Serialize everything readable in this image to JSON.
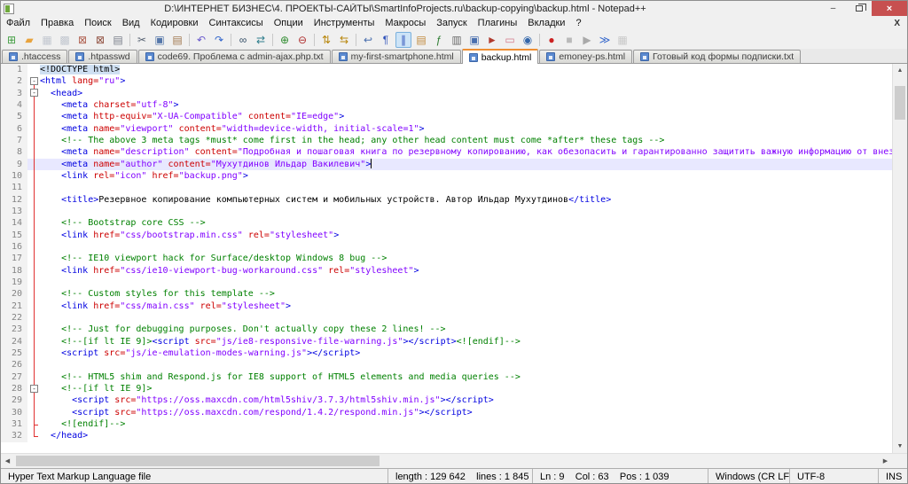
{
  "window": {
    "title": "D:\\ИНТЕРНЕТ БИЗНЕС\\4. ПРОЕКТЫ-САЙТЫ\\SmartInfoProjects.ru\\backup-copying\\backup.html - Notepad++",
    "buttons": {
      "minimize": "–",
      "close": "×"
    },
    "menu_close": "X"
  },
  "menu": [
    "Файл",
    "Правка",
    "Поиск",
    "Вид",
    "Кодировки",
    "Синтаксисы",
    "Опции",
    "Инструменты",
    "Макросы",
    "Запуск",
    "Плагины",
    "Вкладки",
    "?"
  ],
  "toolbar": {
    "groups": [
      [
        {
          "name": "new-file",
          "glyph": "⊞",
          "color": "#3f9d3f"
        },
        {
          "name": "open-file",
          "glyph": "▰",
          "color": "#e8a33d"
        },
        {
          "name": "save-file",
          "glyph": "▦",
          "color": "#8a94a8",
          "disabled": true
        },
        {
          "name": "save-all",
          "glyph": "▩",
          "color": "#8a94a8",
          "disabled": true
        },
        {
          "name": "close-file",
          "glyph": "⊠",
          "color": "#b06050"
        },
        {
          "name": "close-all",
          "glyph": "⊠",
          "color": "#905040"
        },
        {
          "name": "print",
          "glyph": "▤",
          "color": "#7a7f8a"
        }
      ],
      [
        {
          "name": "cut",
          "glyph": "✂",
          "color": "#556070"
        },
        {
          "name": "copy",
          "glyph": "▣",
          "color": "#5577aa"
        },
        {
          "name": "paste",
          "glyph": "▤",
          "color": "#a07850"
        }
      ],
      [
        {
          "name": "undo",
          "glyph": "↶",
          "color": "#6a5acd"
        },
        {
          "name": "redo",
          "glyph": "↷",
          "color": "#3366cc"
        }
      ],
      [
        {
          "name": "find",
          "glyph": "∞",
          "color": "#334d66"
        },
        {
          "name": "replace",
          "glyph": "⇄",
          "color": "#2e7d8c"
        }
      ],
      [
        {
          "name": "zoom-in",
          "glyph": "⊕",
          "color": "#2e8b2e"
        },
        {
          "name": "zoom-out",
          "glyph": "⊖",
          "color": "#b03030"
        }
      ],
      [
        {
          "name": "sync-vertical-scroll",
          "glyph": "⇅",
          "color": "#b8860b"
        },
        {
          "name": "sync-horizontal-scroll",
          "glyph": "⇆",
          "color": "#b8860b"
        }
      ],
      [
        {
          "name": "word-wrap",
          "glyph": "↩",
          "color": "#4a6fae"
        },
        {
          "name": "show-all-characters",
          "glyph": "¶",
          "color": "#3355bb"
        },
        {
          "name": "show-indent-guide",
          "glyph": "∥",
          "color": "#3355bb",
          "active": true
        },
        {
          "name": "doc-map",
          "glyph": "▤",
          "color": "#c08a3e"
        },
        {
          "name": "function-list",
          "glyph": "ƒ",
          "color": "#2e7d32"
        },
        {
          "name": "doc-switcher",
          "glyph": "▥",
          "color": "#6a6a6a"
        },
        {
          "name": "clone-document",
          "glyph": "▣",
          "color": "#4a6fae"
        },
        {
          "name": "export",
          "glyph": "►",
          "color": "#b03a2e"
        },
        {
          "name": "mime-tools",
          "glyph": "▭",
          "color": "#d4788a"
        },
        {
          "name": "view-eye",
          "glyph": "◉",
          "color": "#3366aa"
        }
      ],
      [
        {
          "name": "record-macro",
          "glyph": "●",
          "color": "#cc2222"
        },
        {
          "name": "stop-macro",
          "glyph": "■",
          "color": "#777777",
          "disabled": true
        },
        {
          "name": "play-macro",
          "glyph": "▶",
          "color": "#555555",
          "disabled": true
        },
        {
          "name": "run-macro-multiple",
          "glyph": "≫",
          "color": "#3366cc"
        },
        {
          "name": "save-macro",
          "glyph": "▦",
          "color": "#999999",
          "disabled": true
        }
      ]
    ]
  },
  "tabs": [
    {
      "label": ".htaccess",
      "active": false
    },
    {
      "label": ".htpasswd",
      "active": false
    },
    {
      "label": "code69. Проблема с admin-ajax.php.txt",
      "active": false
    },
    {
      "label": "my-first-smartphone.html",
      "active": false
    },
    {
      "label": "backup.html",
      "active": true
    },
    {
      "label": "emoney-ps.html",
      "active": false
    },
    {
      "label": "Готовый код формы подписки.txt",
      "active": false
    }
  ],
  "editor": {
    "lines": [
      {
        "n": 1,
        "fold": "none",
        "seg": [
          [
            "d",
            "<!DOCTYPE html>"
          ]
        ]
      },
      {
        "n": 2,
        "fold": "boxstart",
        "seg": [
          [
            "t",
            "<html "
          ],
          [
            "a",
            "lang="
          ],
          [
            "v",
            "\"ru\""
          ],
          [
            "t",
            ">"
          ]
        ]
      },
      {
        "n": 3,
        "fold": "box",
        "seg": [
          [
            "x",
            "  "
          ],
          [
            "t",
            "<head>"
          ]
        ]
      },
      {
        "n": 4,
        "fold": "line",
        "seg": [
          [
            "x",
            "    "
          ],
          [
            "t",
            "<meta "
          ],
          [
            "a",
            "charset="
          ],
          [
            "v",
            "\"utf-8\""
          ],
          [
            "t",
            ">"
          ]
        ]
      },
      {
        "n": 5,
        "fold": "line",
        "seg": [
          [
            "x",
            "    "
          ],
          [
            "t",
            "<meta "
          ],
          [
            "a",
            "http-equiv="
          ],
          [
            "v",
            "\"X-UA-Compatible\""
          ],
          [
            "x",
            " "
          ],
          [
            "a",
            "content="
          ],
          [
            "v",
            "\"IE=edge\""
          ],
          [
            "t",
            ">"
          ]
        ]
      },
      {
        "n": 6,
        "fold": "line",
        "seg": [
          [
            "x",
            "    "
          ],
          [
            "t",
            "<meta "
          ],
          [
            "a",
            "name="
          ],
          [
            "v",
            "\"viewport\""
          ],
          [
            "x",
            " "
          ],
          [
            "a",
            "content="
          ],
          [
            "v",
            "\"width=device-width, initial-scale=1\""
          ],
          [
            "t",
            ">"
          ]
        ]
      },
      {
        "n": 7,
        "fold": "line",
        "seg": [
          [
            "x",
            "    "
          ],
          [
            "c",
            "<!-- The above 3 meta tags *must* come first in the head; any other head content must come *after* these tags -->"
          ]
        ]
      },
      {
        "n": 8,
        "fold": "line",
        "seg": [
          [
            "x",
            "    "
          ],
          [
            "t",
            "<meta "
          ],
          [
            "a",
            "name="
          ],
          [
            "v",
            "\"description\""
          ],
          [
            "x",
            " "
          ],
          [
            "a",
            "content="
          ],
          [
            "v",
            "\"Подробная и пошаговая книга по резервному копированию, как обезопасить и гарантированно защитить важную информацию от внезапной потери\""
          ],
          [
            "t",
            ">"
          ]
        ]
      },
      {
        "n": 9,
        "fold": "line",
        "cur": true,
        "caret": true,
        "seg": [
          [
            "x",
            "    "
          ],
          [
            "t",
            "<meta "
          ],
          [
            "a",
            "name="
          ],
          [
            "v",
            "\"author\""
          ],
          [
            "x",
            " "
          ],
          [
            "a",
            "content="
          ],
          [
            "v",
            "\"Мухутдинов Ильдар Вакилевич\""
          ],
          [
            "t",
            ">"
          ]
        ]
      },
      {
        "n": 10,
        "fold": "line",
        "seg": [
          [
            "x",
            "    "
          ],
          [
            "t",
            "<link "
          ],
          [
            "a",
            "rel="
          ],
          [
            "v",
            "\"icon\""
          ],
          [
            "x",
            " "
          ],
          [
            "a",
            "href="
          ],
          [
            "v",
            "\"backup.png\""
          ],
          [
            "t",
            ">"
          ]
        ]
      },
      {
        "n": 11,
        "fold": "line",
        "seg": []
      },
      {
        "n": 12,
        "fold": "line",
        "seg": [
          [
            "x",
            "    "
          ],
          [
            "t",
            "<title>"
          ],
          [
            "x",
            "Резервное копирование компьютерных систем и мобильных устройств. Автор Ильдар Мухутдинов"
          ],
          [
            "t",
            "</title>"
          ]
        ]
      },
      {
        "n": 13,
        "fold": "line",
        "seg": []
      },
      {
        "n": 14,
        "fold": "line",
        "seg": [
          [
            "x",
            "    "
          ],
          [
            "c",
            "<!-- Bootstrap core CSS -->"
          ]
        ]
      },
      {
        "n": 15,
        "fold": "line",
        "seg": [
          [
            "x",
            "    "
          ],
          [
            "t",
            "<link "
          ],
          [
            "a",
            "href="
          ],
          [
            "v",
            "\"css/bootstrap.min.css\""
          ],
          [
            "x",
            " "
          ],
          [
            "a",
            "rel="
          ],
          [
            "v",
            "\"stylesheet\""
          ],
          [
            "t",
            ">"
          ]
        ]
      },
      {
        "n": 16,
        "fold": "line",
        "seg": []
      },
      {
        "n": 17,
        "fold": "line",
        "seg": [
          [
            "x",
            "    "
          ],
          [
            "c",
            "<!-- IE10 viewport hack for Surface/desktop Windows 8 bug -->"
          ]
        ]
      },
      {
        "n": 18,
        "fold": "line",
        "seg": [
          [
            "x",
            "    "
          ],
          [
            "t",
            "<link "
          ],
          [
            "a",
            "href="
          ],
          [
            "v",
            "\"css/ie10-viewport-bug-workaround.css\""
          ],
          [
            "x",
            " "
          ],
          [
            "a",
            "rel="
          ],
          [
            "v",
            "\"stylesheet\""
          ],
          [
            "t",
            ">"
          ]
        ]
      },
      {
        "n": 19,
        "fold": "line",
        "seg": []
      },
      {
        "n": 20,
        "fold": "line",
        "seg": [
          [
            "x",
            "    "
          ],
          [
            "c",
            "<!-- Custom styles for this template -->"
          ]
        ]
      },
      {
        "n": 21,
        "fold": "line",
        "seg": [
          [
            "x",
            "    "
          ],
          [
            "t",
            "<link "
          ],
          [
            "a",
            "href="
          ],
          [
            "v",
            "\"css/main.css\""
          ],
          [
            "x",
            " "
          ],
          [
            "a",
            "rel="
          ],
          [
            "v",
            "\"stylesheet\""
          ],
          [
            "t",
            ">"
          ]
        ]
      },
      {
        "n": 22,
        "fold": "line",
        "seg": []
      },
      {
        "n": 23,
        "fold": "line",
        "seg": [
          [
            "x",
            "    "
          ],
          [
            "c",
            "<!-- Just for debugging purposes. Don't actually copy these 2 lines! -->"
          ]
        ]
      },
      {
        "n": 24,
        "fold": "line",
        "seg": [
          [
            "x",
            "    "
          ],
          [
            "c",
            "<!--[if lt IE 9]>"
          ],
          [
            "t",
            "<script "
          ],
          [
            "a",
            "src="
          ],
          [
            "v",
            "\"js/ie8-responsive-file-warning.js\""
          ],
          [
            "t",
            "></script>"
          ],
          [
            "c",
            "<![endif]-->"
          ]
        ]
      },
      {
        "n": 25,
        "fold": "line",
        "seg": [
          [
            "x",
            "    "
          ],
          [
            "t",
            "<script "
          ],
          [
            "a",
            "src="
          ],
          [
            "v",
            "\"js/ie-emulation-modes-warning.js\""
          ],
          [
            "t",
            "></script>"
          ]
        ]
      },
      {
        "n": 26,
        "fold": "line",
        "seg": []
      },
      {
        "n": 27,
        "fold": "line",
        "seg": [
          [
            "x",
            "    "
          ],
          [
            "c",
            "<!-- HTML5 shim and Respond.js for IE8 support of HTML5 elements and media queries -->"
          ]
        ]
      },
      {
        "n": 28,
        "fold": "box",
        "seg": [
          [
            "x",
            "    "
          ],
          [
            "c",
            "<!--[if lt IE 9]>"
          ]
        ]
      },
      {
        "n": 29,
        "fold": "line",
        "seg": [
          [
            "x",
            "      "
          ],
          [
            "t",
            "<script "
          ],
          [
            "a",
            "src="
          ],
          [
            "v",
            "\"https://oss.maxcdn.com/html5shiv/3.7.3/html5shiv.min.js\""
          ],
          [
            "t",
            "></script>"
          ]
        ]
      },
      {
        "n": 30,
        "fold": "line",
        "seg": [
          [
            "x",
            "      "
          ],
          [
            "t",
            "<script "
          ],
          [
            "a",
            "src="
          ],
          [
            "v",
            "\"https://oss.maxcdn.com/respond/1.4.2/respond.min.js\""
          ],
          [
            "t",
            "></script>"
          ]
        ]
      },
      {
        "n": 31,
        "fold": "endc",
        "seg": [
          [
            "x",
            "    "
          ],
          [
            "c",
            "<![endif]-->"
          ]
        ]
      },
      {
        "n": 32,
        "fold": "end",
        "seg": [
          [
            "x",
            "  "
          ],
          [
            "t",
            "</head>"
          ]
        ]
      }
    ]
  },
  "statusbar": {
    "doc_type": "Hyper Text Markup Language file",
    "length_lines": "length : 129 642    lines : 1 845",
    "position": "Ln : 9    Col : 63    Pos : 1 039",
    "eol": "Windows (CR LF)",
    "encoding": "UTF-8",
    "mode": "INS"
  },
  "colors": {
    "tag": "#0000e0",
    "attr": "#cc0000",
    "value": "#8000ff",
    "comment": "#008000",
    "text": "#000000",
    "doctype_bg": "#cfe0f2",
    "current_line": "#e8e8ff",
    "active_tab_accent": "#ee8f33",
    "close_button": "#c75050",
    "fold_line": "#e03030"
  }
}
